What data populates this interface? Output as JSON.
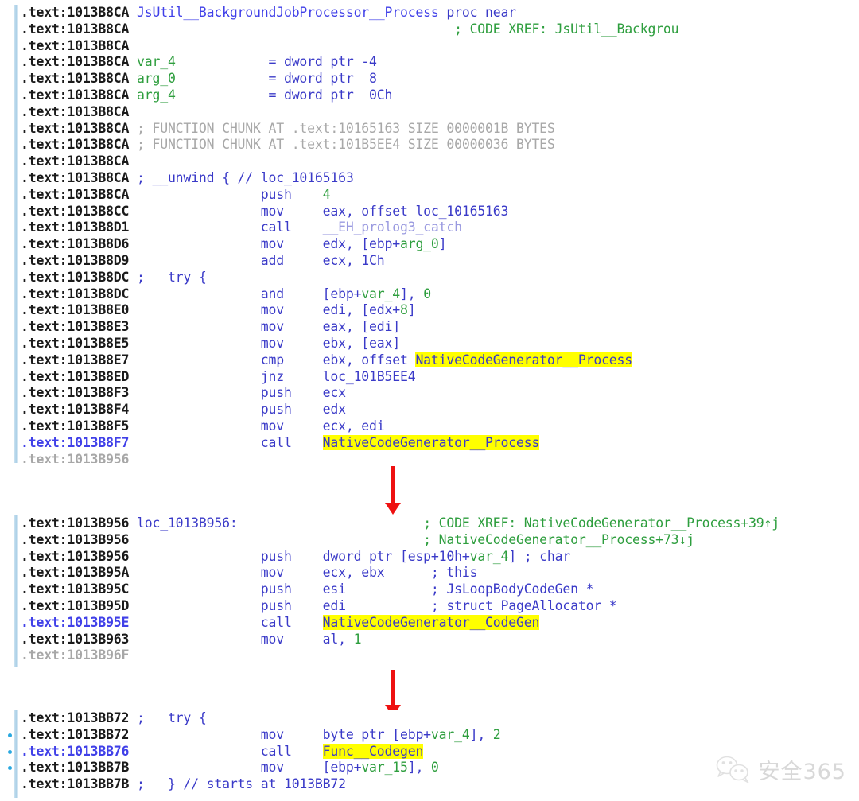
{
  "app": {
    "title": "IDA Pro disassembly view",
    "segment": ".text"
  },
  "colors": {
    "background": "#ffffff",
    "address": "#1a1a1a",
    "address_current": "#4040e8",
    "keyword_blue": "#3a3ac8",
    "green": "#2e9e3e",
    "dim_gray": "#a8a8a8",
    "extern_lavender": "#9a9ae0",
    "highlight_yellow": "#ffff00",
    "arrow_red": "#ee1111",
    "gutter_blue": "#a9cfe6"
  },
  "blocks": [
    {
      "id": "block-1",
      "name": "JsUtil__BackgroundJobProcessor__Process",
      "lines": [
        {
          "addr": ".text:1013B8CA",
          "dot": false,
          "cur": false,
          "tokens": [
            {
              "t": " ",
              "c": "plain"
            },
            {
              "t": "JsUtil__BackgroundJobProcessor__Process",
              "c": "fname"
            },
            {
              "t": " ",
              "c": "plain"
            },
            {
              "t": "proc near",
              "c": "kw"
            }
          ]
        },
        {
          "addr": ".text:1013B8CA",
          "dot": false,
          "cur": false,
          "tokens": [
            {
              "t": "                                          ",
              "c": "plain"
            },
            {
              "t": "; CODE XREF: JsUtil__Backgrou",
              "c": "cmt"
            }
          ]
        },
        {
          "addr": ".text:1013B8CA",
          "dot": false,
          "cur": false,
          "tokens": []
        },
        {
          "addr": ".text:1013B8CA",
          "dot": false,
          "cur": false,
          "tokens": [
            {
              "t": " ",
              "c": "plain"
            },
            {
              "t": "var_4",
              "c": "var"
            },
            {
              "t": "            ",
              "c": "plain"
            },
            {
              "t": "= dword ptr -4",
              "c": "kw"
            }
          ]
        },
        {
          "addr": ".text:1013B8CA",
          "dot": false,
          "cur": false,
          "tokens": [
            {
              "t": " ",
              "c": "plain"
            },
            {
              "t": "arg_0",
              "c": "var"
            },
            {
              "t": "            ",
              "c": "plain"
            },
            {
              "t": "= dword ptr  8",
              "c": "kw"
            }
          ]
        },
        {
          "addr": ".text:1013B8CA",
          "dot": false,
          "cur": false,
          "tokens": [
            {
              "t": " ",
              "c": "plain"
            },
            {
              "t": "arg_4",
              "c": "var"
            },
            {
              "t": "            ",
              "c": "plain"
            },
            {
              "t": "= dword ptr  0Ch",
              "c": "kw"
            }
          ]
        },
        {
          "addr": ".text:1013B8CA",
          "dot": false,
          "cur": false,
          "tokens": []
        },
        {
          "addr": ".text:1013B8CA",
          "dot": false,
          "cur": false,
          "tokens": [
            {
              "t": " ; FUNCTION CHUNK AT .text:10165163 SIZE 0000001B BYTES",
              "c": "dim"
            }
          ]
        },
        {
          "addr": ".text:1013B8CA",
          "dot": false,
          "cur": false,
          "tokens": [
            {
              "t": " ; FUNCTION CHUNK AT .text:101B5EE4 SIZE 00000036 BYTES",
              "c": "dim"
            }
          ]
        },
        {
          "addr": ".text:1013B8CA",
          "dot": false,
          "cur": false,
          "tokens": []
        },
        {
          "addr": ".text:1013B8CA",
          "dot": false,
          "cur": false,
          "tokens": [
            {
              "t": " ; __unwind { // loc_10165163",
              "c": "kw"
            }
          ]
        },
        {
          "addr": ".text:1013B8CA",
          "dot": false,
          "cur": false,
          "tokens": [
            {
              "t": "                 ",
              "c": "plain"
            },
            {
              "t": "push",
              "c": "mn"
            },
            {
              "t": "    ",
              "c": "plain"
            },
            {
              "t": "4",
              "c": "num"
            }
          ]
        },
        {
          "addr": ".text:1013B8CC",
          "dot": false,
          "cur": false,
          "tokens": [
            {
              "t": "                 ",
              "c": "plain"
            },
            {
              "t": "mov",
              "c": "mn"
            },
            {
              "t": "     ",
              "c": "plain"
            },
            {
              "t": "eax, offset loc_10165163",
              "c": "op"
            }
          ]
        },
        {
          "addr": ".text:1013B8D1",
          "dot": false,
          "cur": false,
          "tokens": [
            {
              "t": "                 ",
              "c": "plain"
            },
            {
              "t": "call",
              "c": "mn"
            },
            {
              "t": "    ",
              "c": "plain"
            },
            {
              "t": "__EH_prolog3_catch",
              "c": "extern"
            }
          ]
        },
        {
          "addr": ".text:1013B8D6",
          "dot": false,
          "cur": false,
          "tokens": [
            {
              "t": "                 ",
              "c": "plain"
            },
            {
              "t": "mov",
              "c": "mn"
            },
            {
              "t": "     ",
              "c": "plain"
            },
            {
              "t": "edx, [ebp+",
              "c": "op"
            },
            {
              "t": "arg_0",
              "c": "var"
            },
            {
              "t": "]",
              "c": "op"
            }
          ]
        },
        {
          "addr": ".text:1013B8D9",
          "dot": false,
          "cur": false,
          "tokens": [
            {
              "t": "                 ",
              "c": "plain"
            },
            {
              "t": "add",
              "c": "mn"
            },
            {
              "t": "     ",
              "c": "plain"
            },
            {
              "t": "ecx, 1Ch",
              "c": "op"
            }
          ]
        },
        {
          "addr": ".text:1013B8DC",
          "dot": false,
          "cur": false,
          "tokens": [
            {
              "t": " ;   try {",
              "c": "kw"
            }
          ]
        },
        {
          "addr": ".text:1013B8DC",
          "dot": false,
          "cur": false,
          "tokens": [
            {
              "t": "                 ",
              "c": "plain"
            },
            {
              "t": "and",
              "c": "mn"
            },
            {
              "t": "     ",
              "c": "plain"
            },
            {
              "t": "[ebp+",
              "c": "op"
            },
            {
              "t": "var_4",
              "c": "var"
            },
            {
              "t": "], ",
              "c": "op"
            },
            {
              "t": "0",
              "c": "num"
            }
          ]
        },
        {
          "addr": ".text:1013B8E0",
          "dot": false,
          "cur": false,
          "tokens": [
            {
              "t": "                 ",
              "c": "plain"
            },
            {
              "t": "mov",
              "c": "mn"
            },
            {
              "t": "     ",
              "c": "plain"
            },
            {
              "t": "edi, [edx+",
              "c": "op"
            },
            {
              "t": "8",
              "c": "num"
            },
            {
              "t": "]",
              "c": "op"
            }
          ]
        },
        {
          "addr": ".text:1013B8E3",
          "dot": false,
          "cur": false,
          "tokens": [
            {
              "t": "                 ",
              "c": "plain"
            },
            {
              "t": "mov",
              "c": "mn"
            },
            {
              "t": "     ",
              "c": "plain"
            },
            {
              "t": "eax, [edi]",
              "c": "op"
            }
          ]
        },
        {
          "addr": ".text:1013B8E5",
          "dot": false,
          "cur": false,
          "tokens": [
            {
              "t": "                 ",
              "c": "plain"
            },
            {
              "t": "mov",
              "c": "mn"
            },
            {
              "t": "     ",
              "c": "plain"
            },
            {
              "t": "ebx, [eax]",
              "c": "op"
            }
          ]
        },
        {
          "addr": ".text:1013B8E7",
          "dot": false,
          "cur": false,
          "tokens": [
            {
              "t": "                 ",
              "c": "plain"
            },
            {
              "t": "cmp",
              "c": "mn"
            },
            {
              "t": "     ",
              "c": "plain"
            },
            {
              "t": "ebx, offset ",
              "c": "op"
            },
            {
              "t": "NativeCodeGenerator__Process",
              "c": "hl"
            }
          ]
        },
        {
          "addr": ".text:1013B8ED",
          "dot": false,
          "cur": false,
          "tokens": [
            {
              "t": "                 ",
              "c": "plain"
            },
            {
              "t": "jnz",
              "c": "mn"
            },
            {
              "t": "     ",
              "c": "plain"
            },
            {
              "t": "loc_101B5EE4",
              "c": "op"
            }
          ]
        },
        {
          "addr": ".text:1013B8F3",
          "dot": false,
          "cur": false,
          "tokens": [
            {
              "t": "                 ",
              "c": "plain"
            },
            {
              "t": "push",
              "c": "mn"
            },
            {
              "t": "    ",
              "c": "plain"
            },
            {
              "t": "ecx",
              "c": "op"
            }
          ]
        },
        {
          "addr": ".text:1013B8F4",
          "dot": false,
          "cur": false,
          "tokens": [
            {
              "t": "                 ",
              "c": "plain"
            },
            {
              "t": "push",
              "c": "mn"
            },
            {
              "t": "    ",
              "c": "plain"
            },
            {
              "t": "edx",
              "c": "op"
            }
          ]
        },
        {
          "addr": ".text:1013B8F5",
          "dot": false,
          "cur": false,
          "tokens": [
            {
              "t": "                 ",
              "c": "plain"
            },
            {
              "t": "mov",
              "c": "mn"
            },
            {
              "t": "     ",
              "c": "plain"
            },
            {
              "t": "ecx, edi",
              "c": "op"
            }
          ]
        },
        {
          "addr": ".text:1013B8F7",
          "dot": false,
          "cur": true,
          "tokens": [
            {
              "t": "                 ",
              "c": "plain"
            },
            {
              "t": "call",
              "c": "mn"
            },
            {
              "t": "    ",
              "c": "plain"
            },
            {
              "t": "NativeCodeGenerator__Process",
              "c": "hl"
            }
          ]
        },
        {
          "addr": ".text:1013B956",
          "dot": false,
          "cur": false,
          "clipped": true,
          "tokens": []
        }
      ]
    },
    {
      "id": "block-2",
      "name": "loc_1013B956",
      "lines": [
        {
          "addr": ".text:1013B956",
          "dot": false,
          "cur": false,
          "tokens": [
            {
              "t": " ",
              "c": "plain"
            },
            {
              "t": "loc_1013B956:",
              "c": "kw"
            },
            {
              "t": "                        ",
              "c": "plain"
            },
            {
              "t": "; CODE XREF: NativeCodeGenerator__Process+39↑j",
              "c": "cmt"
            }
          ]
        },
        {
          "addr": ".text:1013B956",
          "dot": false,
          "cur": false,
          "tokens": [
            {
              "t": "                                      ",
              "c": "plain"
            },
            {
              "t": "; NativeCodeGenerator__Process+73↓j",
              "c": "cmt"
            }
          ]
        },
        {
          "addr": ".text:1013B956",
          "dot": false,
          "cur": false,
          "tokens": [
            {
              "t": "                 ",
              "c": "plain"
            },
            {
              "t": "push",
              "c": "mn"
            },
            {
              "t": "    ",
              "c": "plain"
            },
            {
              "t": "dword ptr [esp+10h+",
              "c": "op"
            },
            {
              "t": "var_4",
              "c": "var"
            },
            {
              "t": "] ",
              "c": "op"
            },
            {
              "t": "; char",
              "c": "cmt-blue"
            }
          ]
        },
        {
          "addr": ".text:1013B95A",
          "dot": false,
          "cur": false,
          "tokens": [
            {
              "t": "                 ",
              "c": "plain"
            },
            {
              "t": "mov",
              "c": "mn"
            },
            {
              "t": "     ",
              "c": "plain"
            },
            {
              "t": "ecx, ebx",
              "c": "op"
            },
            {
              "t": "      ",
              "c": "plain"
            },
            {
              "t": "; this",
              "c": "cmt-blue"
            }
          ]
        },
        {
          "addr": ".text:1013B95C",
          "dot": false,
          "cur": false,
          "tokens": [
            {
              "t": "                 ",
              "c": "plain"
            },
            {
              "t": "push",
              "c": "mn"
            },
            {
              "t": "    ",
              "c": "plain"
            },
            {
              "t": "esi",
              "c": "op"
            },
            {
              "t": "           ",
              "c": "plain"
            },
            {
              "t": "; JsLoopBodyCodeGen *",
              "c": "cmt-blue"
            }
          ]
        },
        {
          "addr": ".text:1013B95D",
          "dot": false,
          "cur": false,
          "tokens": [
            {
              "t": "                 ",
              "c": "plain"
            },
            {
              "t": "push",
              "c": "mn"
            },
            {
              "t": "    ",
              "c": "plain"
            },
            {
              "t": "edi",
              "c": "op"
            },
            {
              "t": "           ",
              "c": "plain"
            },
            {
              "t": "; struct PageAllocator *",
              "c": "cmt-blue"
            }
          ]
        },
        {
          "addr": ".text:1013B95E",
          "dot": false,
          "cur": true,
          "tokens": [
            {
              "t": "                 ",
              "c": "plain"
            },
            {
              "t": "call",
              "c": "mn"
            },
            {
              "t": "    ",
              "c": "plain"
            },
            {
              "t": "NativeCodeGenerator__CodeGen",
              "c": "hl"
            }
          ]
        },
        {
          "addr": ".text:1013B963",
          "dot": false,
          "cur": false,
          "tokens": [
            {
              "t": "                 ",
              "c": "plain"
            },
            {
              "t": "mov",
              "c": "mn"
            },
            {
              "t": "     ",
              "c": "plain"
            },
            {
              "t": "al, ",
              "c": "op"
            },
            {
              "t": "1",
              "c": "num"
            }
          ]
        },
        {
          "addr": ".text:1013B96F",
          "dot": false,
          "cur": false,
          "clipped": true,
          "tokens": []
        }
      ]
    },
    {
      "id": "block-3",
      "name": "Func__Codegen call site",
      "lines": [
        {
          "addr": ".text:1013BB72",
          "dot": false,
          "cur": false,
          "tokens": [
            {
              "t": " ;   try {",
              "c": "kw"
            }
          ]
        },
        {
          "addr": ".text:1013BB72",
          "dot": true,
          "cur": false,
          "tokens": [
            {
              "t": "                 ",
              "c": "plain"
            },
            {
              "t": "mov",
              "c": "mn"
            },
            {
              "t": "     ",
              "c": "plain"
            },
            {
              "t": "byte ptr [ebp+",
              "c": "op"
            },
            {
              "t": "var_4",
              "c": "var"
            },
            {
              "t": "], ",
              "c": "op"
            },
            {
              "t": "2",
              "c": "num"
            }
          ]
        },
        {
          "addr": ".text:1013BB76",
          "dot": true,
          "cur": true,
          "tokens": [
            {
              "t": "                 ",
              "c": "plain"
            },
            {
              "t": "call",
              "c": "mn"
            },
            {
              "t": "    ",
              "c": "plain"
            },
            {
              "t": "Func__Codegen",
              "c": "hl"
            }
          ]
        },
        {
          "addr": ".text:1013BB7B",
          "dot": true,
          "cur": false,
          "tokens": [
            {
              "t": "                 ",
              "c": "plain"
            },
            {
              "t": "mov",
              "c": "mn"
            },
            {
              "t": "     ",
              "c": "plain"
            },
            {
              "t": "[ebp+",
              "c": "op"
            },
            {
              "t": "var_15",
              "c": "var"
            },
            {
              "t": "], ",
              "c": "op"
            },
            {
              "t": "0",
              "c": "num"
            }
          ]
        },
        {
          "addr": ".text:1013BB7B",
          "dot": false,
          "cur": false,
          "tokens": [
            {
              "t": " ;   } // starts at 1013BB72",
              "c": "kw"
            }
          ]
        }
      ]
    }
  ],
  "arrows": [
    {
      "name": "arrow-block1-to-block2"
    },
    {
      "name": "arrow-block2-to-block3"
    }
  ],
  "watermark": {
    "text": "安全365",
    "icon": "wechat-icon"
  }
}
